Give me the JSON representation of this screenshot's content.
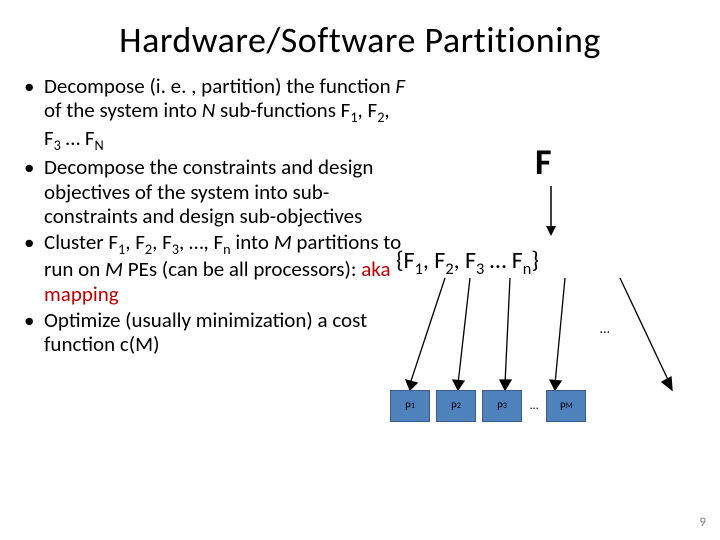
{
  "title": "Hardware/Software Partitioning",
  "bullets": {
    "b1a": "Decompose (i. e. , partition) the function ",
    "b1b": "F",
    "b1c": " of the system into ",
    "b1d": "N",
    "b1e": " sub-functions F",
    "b1f": "1",
    "b1g": ", F",
    "b1h": "2",
    "b1i": ", F",
    "b1j": "3",
    "b1k": " … F",
    "b1l": "N",
    "b2": "Decompose the constraints and design objectives of the system into sub-constraints and design sub-objectives",
    "b3a": "Cluster F",
    "b3b": "1",
    "b3c": ", F",
    "b3d": "2",
    "b3e": ", F",
    "b3f": "3",
    "b3g": ", …, F",
    "b3h": "n",
    "b3i": " into ",
    "b3j": "M",
    "b3k": " partitions to run on ",
    "b3l": "M",
    "b3m": " PEs (can be all processors): ",
    "b3n": "aka mapping",
    "b4": "Optimize (usually minimization) a cost function c(M)"
  },
  "diagram": {
    "F": "F",
    "set_open": "{F",
    "s1": "1",
    "sep": ", F",
    "s2": "2",
    "s3": "3",
    "dots": " … F",
    "sn": "n",
    "set_close": "}",
    "mid_dots": "…",
    "box_dots": "…",
    "p": "P",
    "p1": "1",
    "p2": "2",
    "p3": "3",
    "pM": "M"
  },
  "page": "9"
}
